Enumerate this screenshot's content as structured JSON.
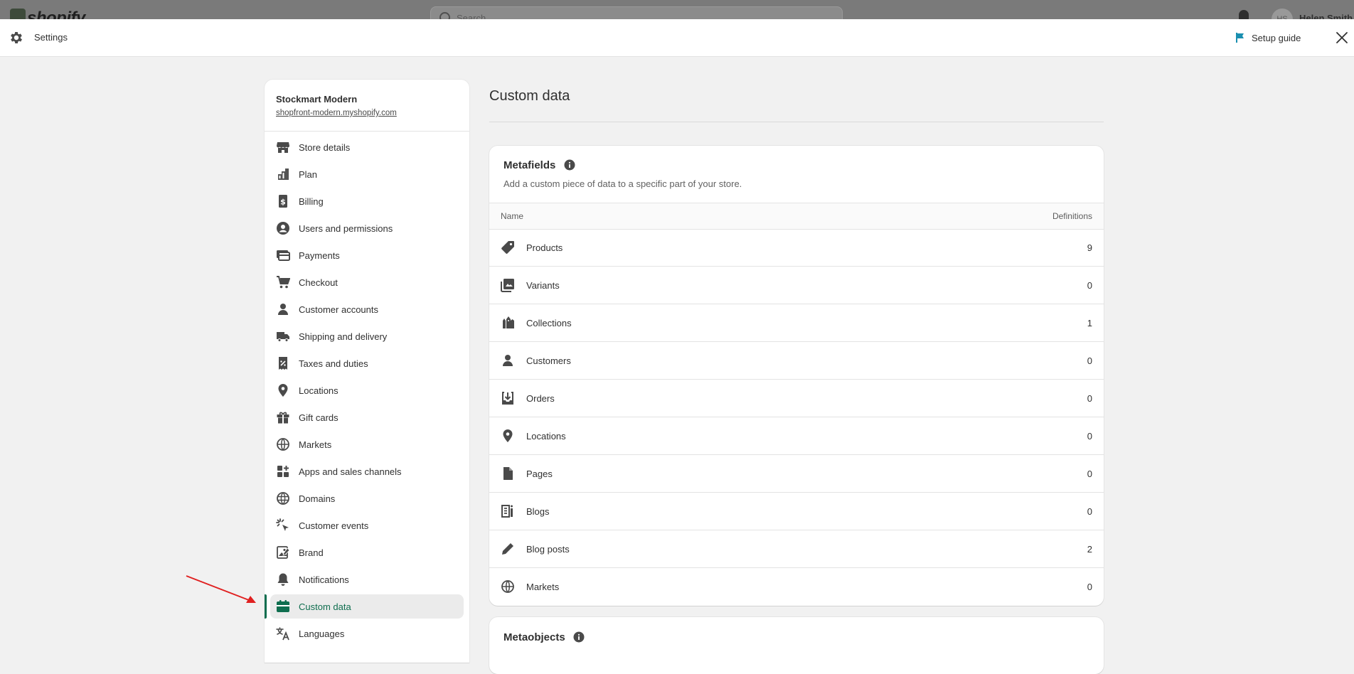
{
  "behind": {
    "logo": "shopify",
    "search_placeholder": "Search",
    "avatar_initials": "HS",
    "user_name": "Helen Smith"
  },
  "topbar": {
    "title": "Settings",
    "setup_guide": "Setup guide"
  },
  "store": {
    "name": "Stockmart Modern",
    "url": "shopfront-modern.myshopify.com"
  },
  "nav": [
    {
      "label": "Store details",
      "icon": "store-icon"
    },
    {
      "label": "Plan",
      "icon": "plan-icon"
    },
    {
      "label": "Billing",
      "icon": "billing-icon"
    },
    {
      "label": "Users and permissions",
      "icon": "user-circle-icon"
    },
    {
      "label": "Payments",
      "icon": "payments-icon"
    },
    {
      "label": "Checkout",
      "icon": "cart-icon"
    },
    {
      "label": "Customer accounts",
      "icon": "person-icon"
    },
    {
      "label": "Shipping and delivery",
      "icon": "truck-icon"
    },
    {
      "label": "Taxes and duties",
      "icon": "receipt-icon"
    },
    {
      "label": "Locations",
      "icon": "location-pin-icon"
    },
    {
      "label": "Gift cards",
      "icon": "gift-icon"
    },
    {
      "label": "Markets",
      "icon": "globe-icon"
    },
    {
      "label": "Apps and sales channels",
      "icon": "apps-icon"
    },
    {
      "label": "Domains",
      "icon": "world-icon"
    },
    {
      "label": "Customer events",
      "icon": "sparkle-icon"
    },
    {
      "label": "Brand",
      "icon": "brand-icon"
    },
    {
      "label": "Notifications",
      "icon": "bell-icon"
    },
    {
      "label": "Custom data",
      "icon": "custom-data-icon",
      "active": true
    },
    {
      "label": "Languages",
      "icon": "translate-icon"
    }
  ],
  "main": {
    "page_title": "Custom data",
    "metafields": {
      "title": "Metafields",
      "subtitle": "Add a custom piece of data to a specific part of your store.",
      "col_name": "Name",
      "col_definitions": "Definitions",
      "rows": [
        {
          "name": "Products",
          "count": "9",
          "icon": "tag-icon"
        },
        {
          "name": "Variants",
          "count": "0",
          "icon": "variants-icon"
        },
        {
          "name": "Collections",
          "count": "1",
          "icon": "collections-icon"
        },
        {
          "name": "Customers",
          "count": "0",
          "icon": "person-icon"
        },
        {
          "name": "Orders",
          "count": "0",
          "icon": "inbox-icon"
        },
        {
          "name": "Locations",
          "count": "0",
          "icon": "location-pin-icon"
        },
        {
          "name": "Pages",
          "count": "0",
          "icon": "page-icon"
        },
        {
          "name": "Blogs",
          "count": "0",
          "icon": "blog-icon"
        },
        {
          "name": "Blog posts",
          "count": "2",
          "icon": "pencil-icon"
        },
        {
          "name": "Markets",
          "count": "0",
          "icon": "globe-icon"
        }
      ]
    },
    "metaobjects": {
      "title": "Metaobjects"
    }
  },
  "colors": {
    "accent_green": "#0f6e4f",
    "annotation_arrow": "#e02020",
    "setup_flag": "#1a8fb0"
  }
}
